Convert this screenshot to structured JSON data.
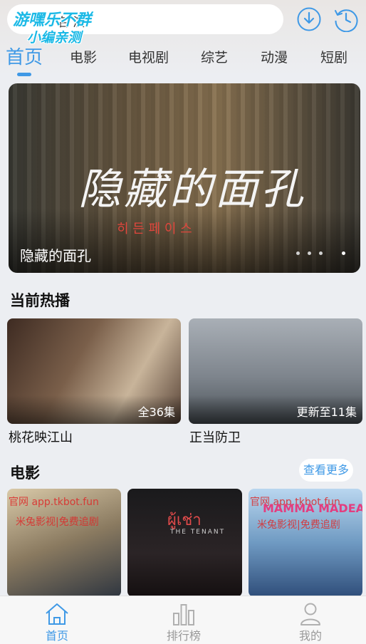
{
  "header": {
    "search_text": "名 演",
    "watermark_line1": "游嘿乐不群",
    "watermark_line2": "小编亲测",
    "download_icon": "download-icon",
    "history_icon": "history-icon"
  },
  "tabs": [
    {
      "label": "首页",
      "active": true
    },
    {
      "label": "电影"
    },
    {
      "label": "电视剧"
    },
    {
      "label": "综艺"
    },
    {
      "label": "动漫"
    },
    {
      "label": "短剧"
    }
  ],
  "banner": {
    "art_title": "隐藏的面孔",
    "art_subtitle": "히 든  페 이 스",
    "caption": "隐藏的面孔",
    "page_count": 4,
    "active_page": 4
  },
  "now_playing": {
    "title": "当前热播",
    "items": [
      {
        "title": "桃花映江山",
        "badge": "全36集"
      },
      {
        "title": "正当防卫",
        "badge": "更新至11集"
      }
    ]
  },
  "movies": {
    "title": "电影",
    "more_label": "查看更多",
    "posters": [
      {
        "overlay_top": "官网   app.tkbot.fun",
        "overlay_mid": "米兔影视|免费追剧"
      },
      {
        "overlay_top": "ผู้เช่า",
        "overlay_mid": "THE TENANT"
      },
      {
        "overlay_top": "官网   app.tkbot.fun",
        "overlay_mid": "米兔影视|免费追剧",
        "art_text": "MAMMA MADEA"
      }
    ]
  },
  "bottom_nav": [
    {
      "label": "首页",
      "icon": "home-icon",
      "active": true
    },
    {
      "label": "排行榜",
      "icon": "ranking-icon"
    },
    {
      "label": "我的",
      "icon": "profile-icon"
    }
  ],
  "colors": {
    "accent": "#3f99e6",
    "watermark": "#1bb9e6",
    "background": "#eceef2"
  }
}
